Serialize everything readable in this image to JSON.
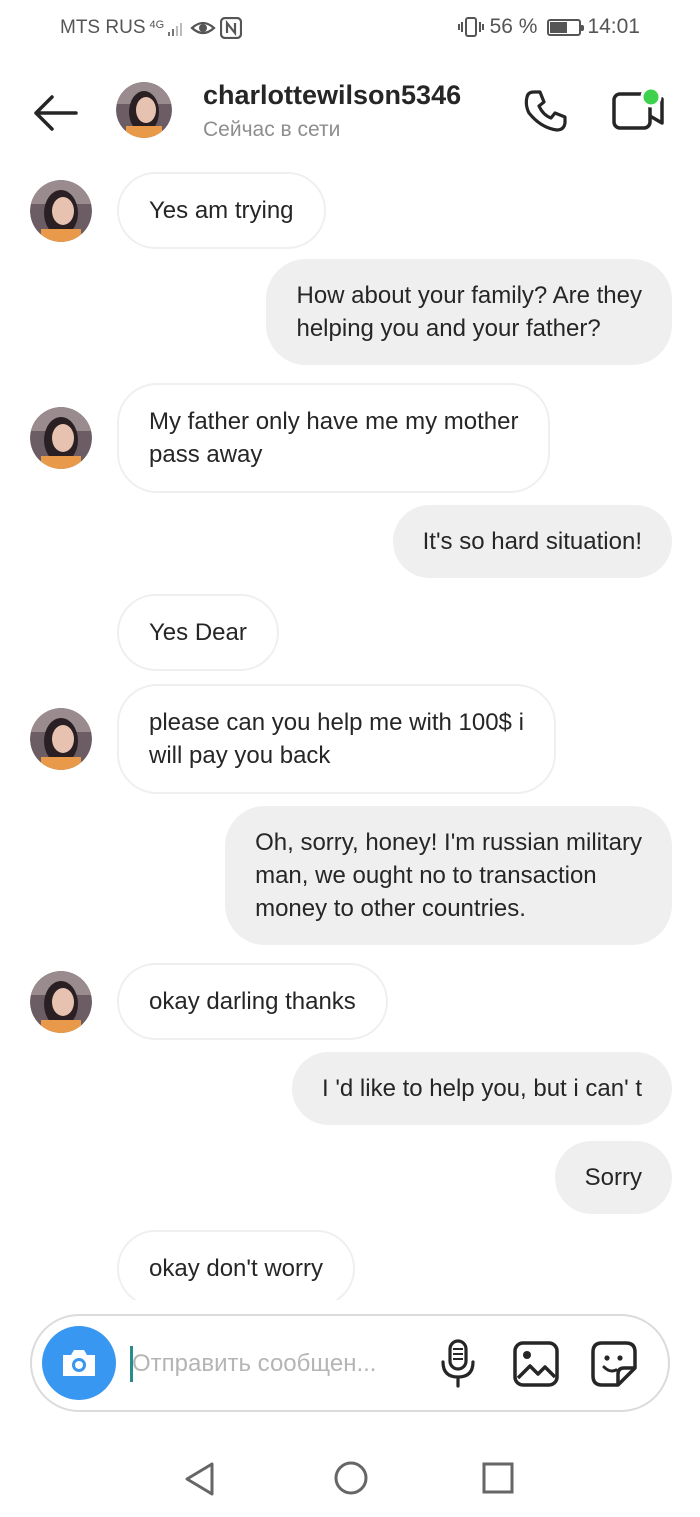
{
  "status_bar": {
    "carrier": "MTS RUS",
    "network": "4G",
    "battery_text": "56 %",
    "battery_level": 0.56,
    "time": "14:01"
  },
  "header": {
    "username": "charlottewilson5346",
    "status": "Сейчас в сети",
    "online_dot_color": "#3ed14b"
  },
  "messages": [
    {
      "from": "them",
      "text": "Yes am trying",
      "avatar": true
    },
    {
      "from": "me",
      "text": "How about your family? Are they\nhelping you and your father?"
    },
    {
      "from": "them",
      "text": "My father only have me my mother\npass away",
      "avatar": true
    },
    {
      "from": "me",
      "text": "It's so hard situation!"
    },
    {
      "from": "them",
      "text": "Yes Dear",
      "avatar": false
    },
    {
      "from": "them",
      "text": "please can you help me with 100$ i\nwill pay you back",
      "avatar": true
    },
    {
      "from": "me",
      "text": "Oh, sorry, honey! I'm russian military\nman, we ought no to transaction\nmoney to other countries."
    },
    {
      "from": "them",
      "text": "okay darling thanks",
      "avatar": true
    },
    {
      "from": "me",
      "text": "I 'd like to help you, but i can' t"
    },
    {
      "from": "me",
      "text": "Sorry"
    },
    {
      "from": "them",
      "text": "okay don't worry",
      "avatar": false
    }
  ],
  "composer": {
    "placeholder": "Отправить сообщен..."
  },
  "colors": {
    "accent": "#3897f0",
    "outgoing_bubble": "#efefef",
    "text": "#262626",
    "muted": "#8e8e8e"
  },
  "icons": [
    "arrow-left-icon",
    "phone-icon",
    "video-camera-icon",
    "camera-icon",
    "microphone-icon",
    "image-icon",
    "sticker-icon",
    "nav-back-icon",
    "nav-home-icon",
    "nav-recent-icon"
  ]
}
